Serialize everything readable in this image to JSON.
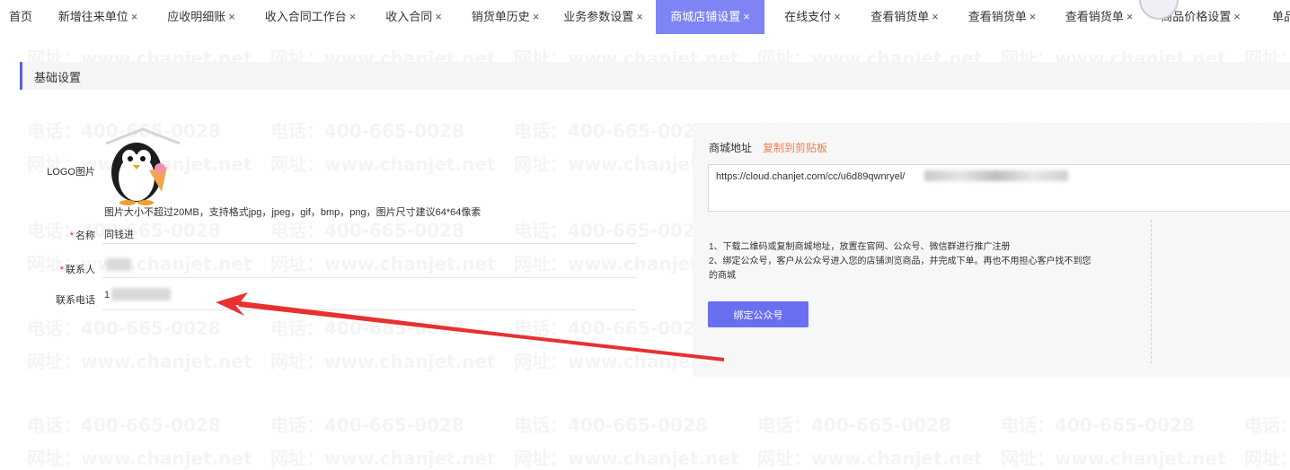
{
  "tabs": [
    {
      "label": "首页",
      "closable": false
    },
    {
      "label": "新增往来单位",
      "closable": true
    },
    {
      "label": "应收明细账",
      "closable": true
    },
    {
      "label": "收入合同工作台",
      "closable": true
    },
    {
      "label": "收入合同",
      "closable": true
    },
    {
      "label": "销货单历史",
      "closable": true
    },
    {
      "label": "业务参数设置",
      "closable": true
    },
    {
      "label": "商城店铺设置",
      "closable": true,
      "active": true
    },
    {
      "label": "在线支付",
      "closable": true
    },
    {
      "label": "查看销货单",
      "closable": true
    },
    {
      "label": "查看销货单",
      "closable": true
    },
    {
      "label": "查看销货单",
      "closable": true
    },
    {
      "label": "商品价格设置",
      "closable": true
    },
    {
      "label": "单品",
      "closable": false
    }
  ],
  "close_glyph": "×",
  "section": {
    "title": "基础设置"
  },
  "form": {
    "logo_label": "LOGO图片",
    "logo_hint": "图片大小不超过20MB，支持格式jpg，jpeg，gif，bmp，png，图片尺寸建议64*64像素",
    "required_mark": "*",
    "name_label": "名称",
    "name_value": "同钱进",
    "contact_label": "联系人",
    "phone_label": "联系电话",
    "phone_prefix": "1"
  },
  "mall": {
    "address_label": "商城地址",
    "copy_label": "复制到剪贴板",
    "url_visible": "https://cloud.chanjet.com/cc/u6d89qwnryel/",
    "tips": [
      "1、下载二维码或复制商城地址，放置在官网、公众号、微信群进行推广注册",
      "2、绑定公众号，客户从公众号进入您的店铺浏览商品，并完成下单。再也不用担心客户找不到您",
      "的商城"
    ],
    "bind_button": "绑定公众号"
  },
  "watermark": {
    "phone": "电话：400-665-0028",
    "site": "网址：www.chanjet.net"
  },
  "colors": {
    "accent": "#7f84f5",
    "button": "#6a6ff2",
    "link": "#f08050",
    "arrow": "#e83030",
    "required": "#e02020"
  },
  "icons": {
    "logo": "penguin-logo-icon",
    "arrow": "annotation-arrow-icon"
  }
}
